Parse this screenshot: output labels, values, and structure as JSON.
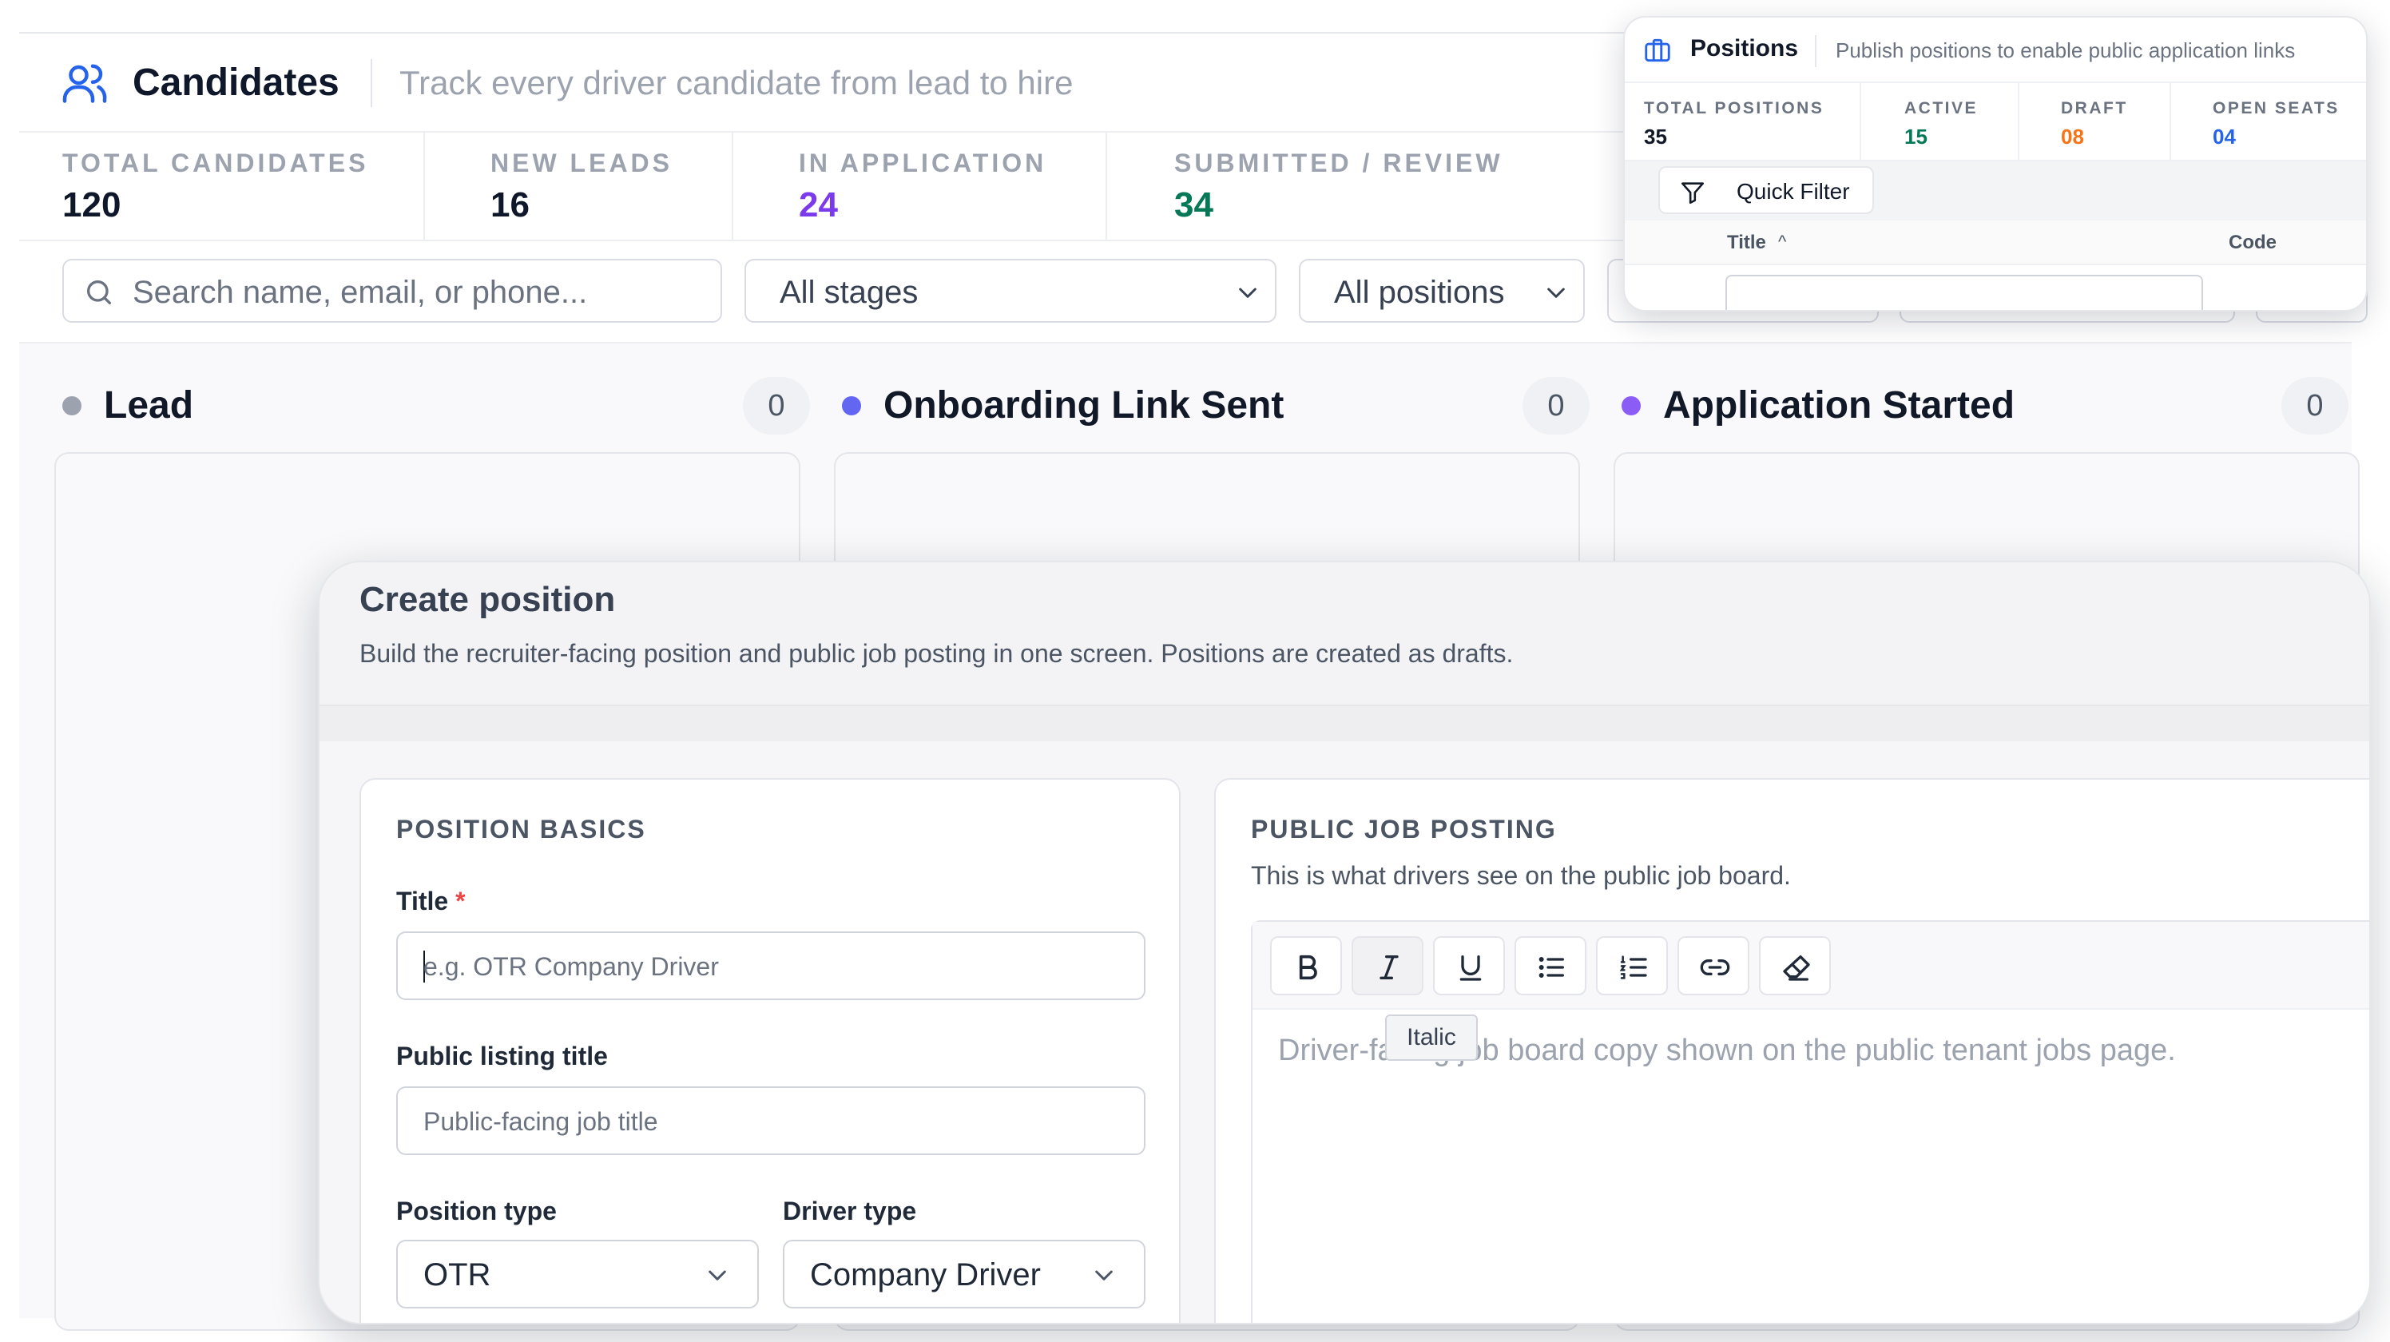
{
  "header": {
    "title": "Candidates",
    "subtitle": "Track every driver candidate from lead to hire"
  },
  "stats": [
    {
      "label": "TOTAL CANDIDATES",
      "value": "120",
      "color": "#0f172a"
    },
    {
      "label": "NEW LEADS",
      "value": "16",
      "color": "#0f172a"
    },
    {
      "label": "IN APPLICATION",
      "value": "24",
      "color": "#7c3aed"
    },
    {
      "label": "SUBMITTED / REVIEW",
      "value": "34",
      "color": "#047857"
    }
  ],
  "filters": {
    "search_placeholder": "Search name, email, or phone...",
    "stage_value": "All stages",
    "position_value": "All positions"
  },
  "columns": [
    {
      "title": "Lead",
      "count": "0",
      "dot_color": "#9ca3af"
    },
    {
      "title": "Onboarding Link Sent",
      "count": "0",
      "dot_color": "#6366f1"
    },
    {
      "title": "Application Started",
      "count": "0",
      "dot_color": "#8b5cf6"
    }
  ],
  "positions_panel": {
    "title": "Positions",
    "subtitle": "Publish positions to enable public application links",
    "stats": [
      {
        "label": "TOTAL POSITIONS",
        "value": "35",
        "color": "#111827"
      },
      {
        "label": "ACTIVE",
        "value": "15",
        "color": "#047857"
      },
      {
        "label": "DRAFT",
        "value": "08",
        "color": "#f97316"
      },
      {
        "label": "OPEN SEATS",
        "value": "04",
        "color": "#2563eb"
      }
    ],
    "quick_filter": "Quick Filter",
    "table_headers": {
      "title": "Title",
      "code": "Code"
    },
    "sort_indicator": "^"
  },
  "modal": {
    "title": "Create position",
    "subtitle": "Build the recruiter-facing position and public job posting in one screen. Positions are created as drafts.",
    "basics": {
      "section_title": "POSITION BASICS",
      "title_label": "Title",
      "required_mark": "*",
      "title_placeholder": "e.g. OTR Company Driver",
      "public_title_label": "Public listing title",
      "public_title_placeholder": "Public-facing job title",
      "position_type_label": "Position type",
      "position_type_value": "OTR",
      "driver_type_label": "Driver type",
      "driver_type_value": "Company Driver"
    },
    "posting": {
      "section_title": "PUBLIC JOB POSTING",
      "description": "This is what drivers see on the public job board.",
      "editor_placeholder": "Driver-facing job board copy shown on the public tenant jobs page.",
      "tooltip": "Italic",
      "toolbar_icons": [
        "bold-icon",
        "italic-icon",
        "underline-icon",
        "bullet-list-icon",
        "numbered-list-icon",
        "link-icon",
        "eraser-icon"
      ]
    }
  },
  "colors": {
    "accent": "#2563eb",
    "purple": "#7c3aed",
    "green": "#047857",
    "orange": "#f97316"
  }
}
